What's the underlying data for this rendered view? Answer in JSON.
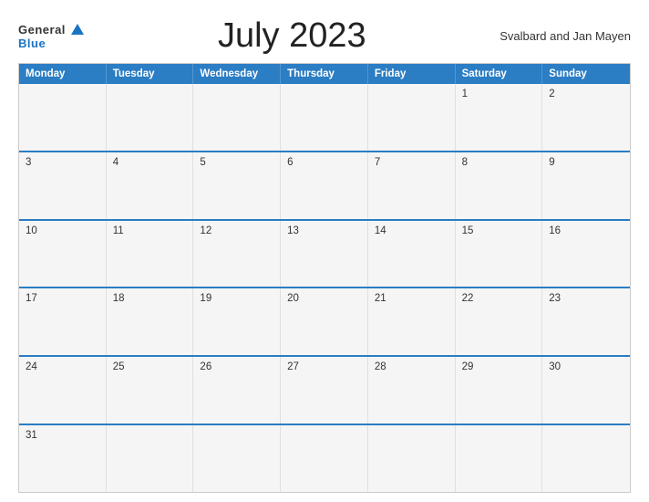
{
  "header": {
    "logo_general": "General",
    "logo_blue": "Blue",
    "title": "July 2023",
    "region": "Svalbard and Jan Mayen"
  },
  "weekdays": [
    "Monday",
    "Tuesday",
    "Wednesday",
    "Thursday",
    "Friday",
    "Saturday",
    "Sunday"
  ],
  "weeks": [
    [
      null,
      null,
      null,
      null,
      null,
      1,
      2
    ],
    [
      3,
      4,
      5,
      6,
      7,
      8,
      9
    ],
    [
      10,
      11,
      12,
      13,
      14,
      15,
      16
    ],
    [
      17,
      18,
      19,
      20,
      21,
      22,
      23
    ],
    [
      24,
      25,
      26,
      27,
      28,
      29,
      30
    ],
    [
      31,
      null,
      null,
      null,
      null,
      null,
      null
    ]
  ]
}
